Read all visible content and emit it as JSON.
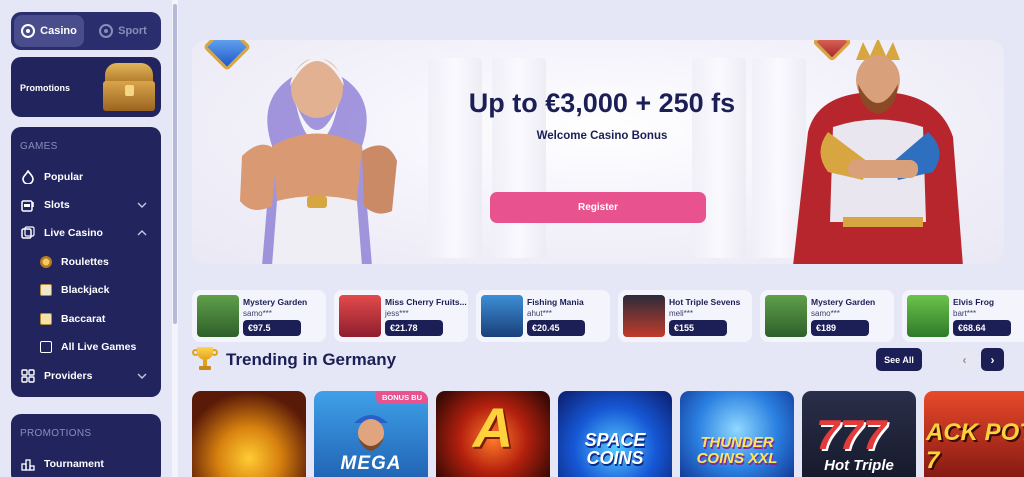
{
  "sidebar": {
    "modes": [
      {
        "label": "Casino",
        "active": true
      },
      {
        "label": "Sport",
        "active": false
      }
    ],
    "promotions_card": {
      "label": "Promotions"
    },
    "games_section_title": "GAMES",
    "nav": [
      {
        "label": "Popular",
        "icon": "flame-icon"
      },
      {
        "label": "Slots",
        "icon": "slot-machine-icon",
        "chevron": "down"
      },
      {
        "label": "Live Casino",
        "icon": "dice-icon",
        "chevron": "up"
      },
      {
        "label": "Roulettes",
        "icon": "roulette-icon"
      },
      {
        "label": "Blackjack",
        "icon": "cards-icon"
      },
      {
        "label": "Baccarat",
        "icon": "baccarat-icon"
      },
      {
        "label": "All Live Games",
        "icon": "box-icon"
      },
      {
        "label": "Providers",
        "icon": "grid-icon",
        "chevron": "down"
      }
    ],
    "promotions_section_title": "PROMOTIONS",
    "promotions_nav": [
      {
        "label": "Tournament",
        "icon": "podium-icon"
      }
    ]
  },
  "hero": {
    "title": "Up to €3,000 + 250 fs",
    "subtitle": "Welcome Casino Bonus",
    "cta": "Register",
    "accent": "#e8528e"
  },
  "ticker": [
    {
      "game": "Mystery Garden",
      "user": "samo***",
      "amount": "€97.5"
    },
    {
      "game": "Miss Cherry Fruits...",
      "user": "jess***",
      "amount": "€21.78"
    },
    {
      "game": "Fishing Mania",
      "user": "ahut***",
      "amount": "€20.45"
    },
    {
      "game": "Hot Triple Sevens",
      "user": "meli***",
      "amount": "€155"
    },
    {
      "game": "Mystery Garden",
      "user": "samo***",
      "amount": "€189"
    },
    {
      "game": "Elvis Frog",
      "user": "bart***",
      "amount": "€68.64"
    }
  ],
  "trending": {
    "title": "Trending in Germany",
    "see_all": "See All",
    "prev": "‹",
    "next": "›"
  },
  "tiles": [
    {
      "text": ""
    },
    {
      "text": "MEGA",
      "tag": "BONUS BU"
    },
    {
      "text": "A"
    },
    {
      "text": "SPACE COINS"
    },
    {
      "text": "THUNDER COINS XXL"
    },
    {
      "text": "Hot Triple"
    },
    {
      "text": "ACK POT 7"
    }
  ],
  "colors": {
    "sidebar_bg": "#22245e",
    "page_bg": "#e6e7f6",
    "dark_navy": "#1c1f55",
    "pink": "#e8528e"
  }
}
